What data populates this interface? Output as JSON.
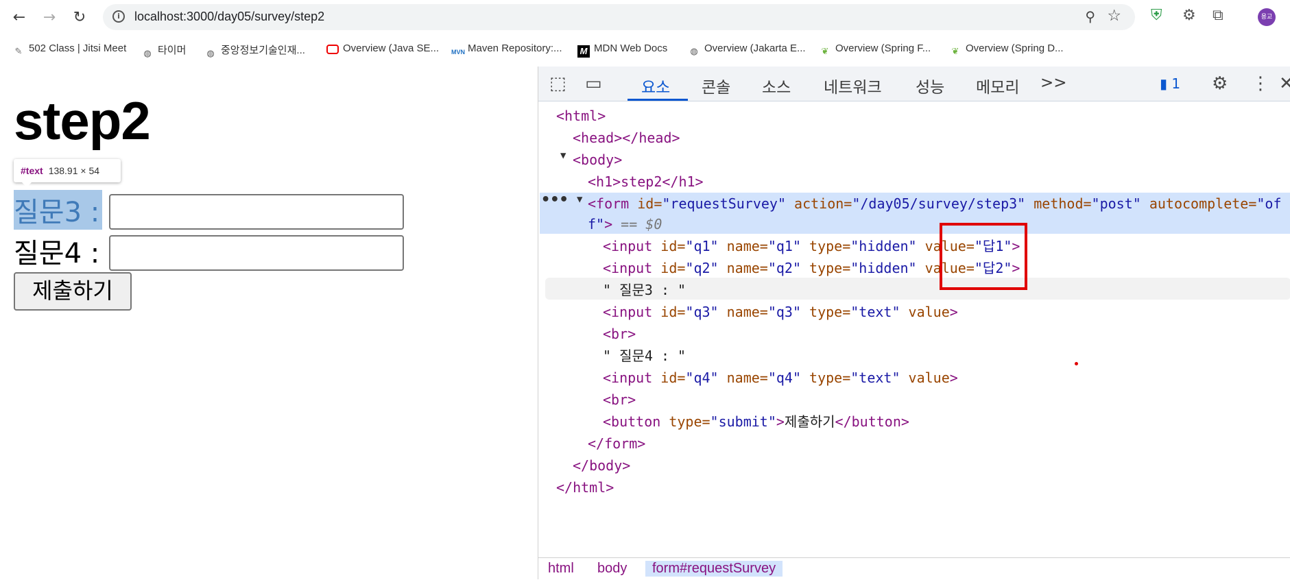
{
  "browser": {
    "url": "localhost:3000/day05/survey/step2",
    "bookmarks": [
      {
        "label": "502 Class | Jitsi Meet",
        "icon": "pen-icon"
      },
      {
        "label": "타이머",
        "icon": "globe-icon"
      },
      {
        "label": "중앙정보기술인재...",
        "icon": "globe-icon"
      },
      {
        "label": "Overview (Java SE...",
        "icon": "oracle-icon"
      },
      {
        "label": "Maven Repository:...",
        "icon": "maven-icon"
      },
      {
        "label": "MDN Web Docs",
        "icon": "mdn-icon"
      },
      {
        "label": "Overview (Jakarta E...",
        "icon": "globe-icon"
      },
      {
        "label": "Overview (Spring F...",
        "icon": "spring-icon"
      },
      {
        "label": "Overview (Spring D...",
        "icon": "spring-icon"
      }
    ],
    "avatar_text": "용교",
    "icons": {
      "back": "←",
      "forward": "→",
      "reload": "↻",
      "info": "i",
      "zoom": "⚲",
      "star": "☆",
      "shield": "⛨",
      "extension": "⧉",
      "puzzle": "⚙"
    }
  },
  "page": {
    "heading": "step2",
    "tooltip": {
      "node": "#text",
      "size": "138.91 × 54"
    },
    "q3_label": "질문3 :",
    "q4_label": "질문4 :",
    "submit_label": "제출하기"
  },
  "devtools": {
    "tabs": [
      "요소",
      "콘솔",
      "소스",
      "네트워크",
      "성능",
      "메모리"
    ],
    "more": ">>",
    "message_count": "1",
    "tree": {
      "html_open": "<html>",
      "head": "<head></head>",
      "body_open": "<body>",
      "h1": "<h1>step2</h1>",
      "form_line1": [
        "<form",
        " id=",
        "\"requestSurvey\"",
        " action=",
        "\"/day05/survey/step3\"",
        " method=",
        "\"post\"",
        " autocomplete=",
        "\"of"
      ],
      "form_line2": [
        "f\"",
        ">",
        " == $0"
      ],
      "input_q1": [
        "<input",
        " id=",
        "\"q1\"",
        " name=",
        "\"q1\"",
        " type=",
        "\"hidden\"",
        " value=",
        "\"답1\"",
        ">"
      ],
      "input_q2": [
        "<input",
        " id=",
        "\"q2\"",
        " name=",
        "\"q2\"",
        " type=",
        "\"hidden\"",
        " value=",
        "\"답2\"",
        ">"
      ],
      "text_q3": "\" 질문3 : \"",
      "input_q3": [
        "<input",
        " id=",
        "\"q3\"",
        " name=",
        "\"q3\"",
        " type=",
        "\"text\"",
        " value",
        ">"
      ],
      "br1": "<br>",
      "text_q4": "\" 질문4 : \"",
      "input_q4": [
        "<input",
        " id=",
        "\"q4\"",
        " name=",
        "\"q4\"",
        " type=",
        "\"text\"",
        " value",
        ">"
      ],
      "br2": "<br>",
      "button": [
        "<button",
        " type=",
        "\"submit\"",
        ">",
        "제출하기",
        "</button>"
      ],
      "form_close": "</form>",
      "body_close": "</body>",
      "html_close": "</html>"
    },
    "breadcrumbs": [
      "html",
      "body",
      "form#requestSurvey"
    ]
  },
  "colors": {
    "tag": "#881280",
    "attr": "#994500",
    "value": "#1a1aa6",
    "accent": "#0b57d0",
    "highlight": "#e00000"
  }
}
